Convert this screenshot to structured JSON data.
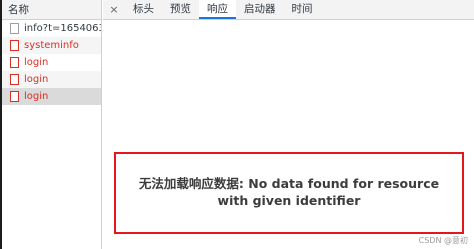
{
  "name_panel": {
    "header": "名称",
    "requests": [
      {
        "label": "info?t=1654063...",
        "status": "ok"
      },
      {
        "label": "systeminfo",
        "status": "error"
      },
      {
        "label": "login",
        "status": "error"
      },
      {
        "label": "login",
        "status": "error"
      },
      {
        "label": "login",
        "status": "error"
      }
    ]
  },
  "tabs": {
    "close_symbol": "×",
    "items": [
      "标头",
      "预览",
      "响应",
      "启动器",
      "时间"
    ],
    "active": "响应"
  },
  "response": {
    "message": "无法加载响应数据: No data found for resource with given identifier"
  },
  "watermark": "CSDN @意初",
  "colors": {
    "error_text": "#d93025",
    "highlight_border": "#e5171b",
    "active_tab_underline": "#1a73e8"
  }
}
